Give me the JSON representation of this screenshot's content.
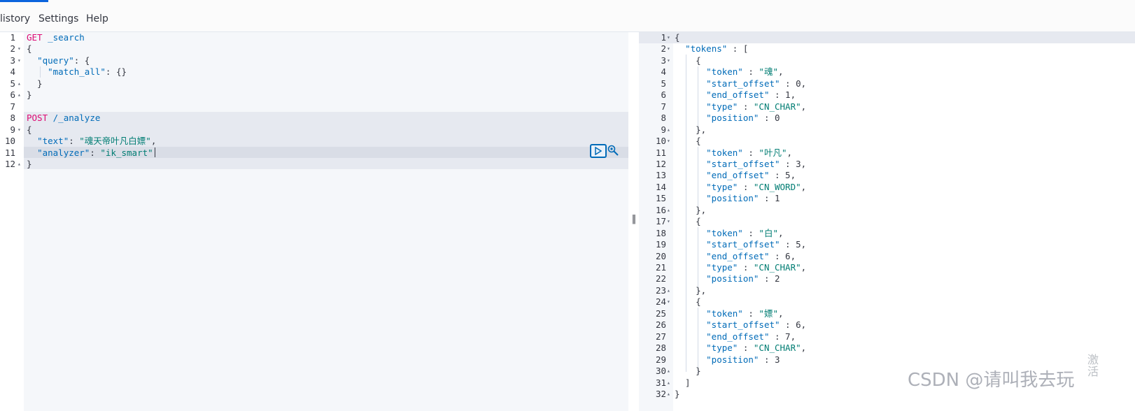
{
  "nav": {
    "tabs": [
      "listory",
      "Settings",
      "Help"
    ]
  },
  "request_editor": {
    "line_numbers": [
      "1",
      "2",
      "3",
      "4",
      "5",
      "6",
      "7",
      "8",
      "9",
      "10",
      "11",
      "12"
    ],
    "lines": [
      {
        "segments": [
          {
            "t": "kw",
            "v": "GET"
          },
          {
            "t": "code",
            "v": " "
          },
          {
            "t": "url",
            "v": "_search"
          }
        ]
      },
      {
        "segments": [
          {
            "t": "code",
            "v": "{"
          }
        ]
      },
      {
        "segments": [
          {
            "t": "code",
            "v": "  "
          },
          {
            "t": "key",
            "v": "\"query\""
          },
          {
            "t": "code",
            "v": ": {"
          }
        ]
      },
      {
        "segments": [
          {
            "t": "code",
            "v": "    "
          },
          {
            "t": "key",
            "v": "\"match_all\""
          },
          {
            "t": "code",
            "v": ": {}"
          }
        ]
      },
      {
        "segments": [
          {
            "t": "code",
            "v": "  }"
          }
        ]
      },
      {
        "segments": [
          {
            "t": "code",
            "v": "}"
          }
        ]
      },
      {
        "segments": []
      },
      {
        "segments": [
          {
            "t": "kw",
            "v": "POST"
          },
          {
            "t": "code",
            "v": " "
          },
          {
            "t": "url",
            "v": "/_analyze"
          }
        ]
      },
      {
        "segments": [
          {
            "t": "code",
            "v": "{"
          }
        ]
      },
      {
        "segments": [
          {
            "t": "code",
            "v": "  "
          },
          {
            "t": "key",
            "v": "\"text\""
          },
          {
            "t": "code",
            "v": ": "
          },
          {
            "t": "str",
            "v": "\"魂天帝叶凡白嫖\""
          },
          {
            "t": "code",
            "v": ","
          }
        ]
      },
      {
        "segments": [
          {
            "t": "code",
            "v": "  "
          },
          {
            "t": "key",
            "v": "\"analyzer\""
          },
          {
            "t": "code",
            "v": ": "
          },
          {
            "t": "str",
            "v": "\"ik_smart\""
          }
        ]
      },
      {
        "segments": [
          {
            "t": "code",
            "v": "}"
          }
        ]
      }
    ],
    "fold_markers": {
      "2": "open",
      "3": "open",
      "5": "close",
      "6": "close",
      "9": "open",
      "12": "close"
    }
  },
  "response_viewer": {
    "line_numbers": [
      "1",
      "2",
      "3",
      "4",
      "5",
      "6",
      "7",
      "8",
      "9",
      "10",
      "11",
      "12",
      "13",
      "14",
      "15",
      "16",
      "17",
      "18",
      "19",
      "20",
      "21",
      "22",
      "23",
      "24",
      "25",
      "26",
      "27",
      "28",
      "29",
      "30",
      "31",
      "32"
    ],
    "lines": [
      {
        "segments": [
          {
            "t": "code",
            "v": "{"
          }
        ]
      },
      {
        "segments": [
          {
            "t": "code",
            "v": "  "
          },
          {
            "t": "key",
            "v": "\"tokens\""
          },
          {
            "t": "code",
            "v": " : ["
          }
        ]
      },
      {
        "segments": [
          {
            "t": "code",
            "v": "    {"
          }
        ]
      },
      {
        "segments": [
          {
            "t": "code",
            "v": "      "
          },
          {
            "t": "key",
            "v": "\"token\""
          },
          {
            "t": "code",
            "v": " : "
          },
          {
            "t": "str",
            "v": "\"魂\""
          },
          {
            "t": "code",
            "v": ","
          }
        ]
      },
      {
        "segments": [
          {
            "t": "code",
            "v": "      "
          },
          {
            "t": "key",
            "v": "\"start_offset\""
          },
          {
            "t": "code",
            "v": " : 0,"
          }
        ]
      },
      {
        "segments": [
          {
            "t": "code",
            "v": "      "
          },
          {
            "t": "key",
            "v": "\"end_offset\""
          },
          {
            "t": "code",
            "v": " : 1,"
          }
        ]
      },
      {
        "segments": [
          {
            "t": "code",
            "v": "      "
          },
          {
            "t": "key",
            "v": "\"type\""
          },
          {
            "t": "code",
            "v": " : "
          },
          {
            "t": "str",
            "v": "\"CN_CHAR\""
          },
          {
            "t": "code",
            "v": ","
          }
        ]
      },
      {
        "segments": [
          {
            "t": "code",
            "v": "      "
          },
          {
            "t": "key",
            "v": "\"position\""
          },
          {
            "t": "code",
            "v": " : 0"
          }
        ]
      },
      {
        "segments": [
          {
            "t": "code",
            "v": "    },"
          }
        ]
      },
      {
        "segments": [
          {
            "t": "code",
            "v": "    {"
          }
        ]
      },
      {
        "segments": [
          {
            "t": "code",
            "v": "      "
          },
          {
            "t": "key",
            "v": "\"token\""
          },
          {
            "t": "code",
            "v": " : "
          },
          {
            "t": "str",
            "v": "\"叶凡\""
          },
          {
            "t": "code",
            "v": ","
          }
        ]
      },
      {
        "segments": [
          {
            "t": "code",
            "v": "      "
          },
          {
            "t": "key",
            "v": "\"start_offset\""
          },
          {
            "t": "code",
            "v": " : 3,"
          }
        ]
      },
      {
        "segments": [
          {
            "t": "code",
            "v": "      "
          },
          {
            "t": "key",
            "v": "\"end_offset\""
          },
          {
            "t": "code",
            "v": " : 5,"
          }
        ]
      },
      {
        "segments": [
          {
            "t": "code",
            "v": "      "
          },
          {
            "t": "key",
            "v": "\"type\""
          },
          {
            "t": "code",
            "v": " : "
          },
          {
            "t": "str",
            "v": "\"CN_WORD\""
          },
          {
            "t": "code",
            "v": ","
          }
        ]
      },
      {
        "segments": [
          {
            "t": "code",
            "v": "      "
          },
          {
            "t": "key",
            "v": "\"position\""
          },
          {
            "t": "code",
            "v": " : 1"
          }
        ]
      },
      {
        "segments": [
          {
            "t": "code",
            "v": "    },"
          }
        ]
      },
      {
        "segments": [
          {
            "t": "code",
            "v": "    {"
          }
        ]
      },
      {
        "segments": [
          {
            "t": "code",
            "v": "      "
          },
          {
            "t": "key",
            "v": "\"token\""
          },
          {
            "t": "code",
            "v": " : "
          },
          {
            "t": "str",
            "v": "\"白\""
          },
          {
            "t": "code",
            "v": ","
          }
        ]
      },
      {
        "segments": [
          {
            "t": "code",
            "v": "      "
          },
          {
            "t": "key",
            "v": "\"start_offset\""
          },
          {
            "t": "code",
            "v": " : 5,"
          }
        ]
      },
      {
        "segments": [
          {
            "t": "code",
            "v": "      "
          },
          {
            "t": "key",
            "v": "\"end_offset\""
          },
          {
            "t": "code",
            "v": " : 6,"
          }
        ]
      },
      {
        "segments": [
          {
            "t": "code",
            "v": "      "
          },
          {
            "t": "key",
            "v": "\"type\""
          },
          {
            "t": "code",
            "v": " : "
          },
          {
            "t": "str",
            "v": "\"CN_CHAR\""
          },
          {
            "t": "code",
            "v": ","
          }
        ]
      },
      {
        "segments": [
          {
            "t": "code",
            "v": "      "
          },
          {
            "t": "key",
            "v": "\"position\""
          },
          {
            "t": "code",
            "v": " : 2"
          }
        ]
      },
      {
        "segments": [
          {
            "t": "code",
            "v": "    },"
          }
        ]
      },
      {
        "segments": [
          {
            "t": "code",
            "v": "    {"
          }
        ]
      },
      {
        "segments": [
          {
            "t": "code",
            "v": "      "
          },
          {
            "t": "key",
            "v": "\"token\""
          },
          {
            "t": "code",
            "v": " : "
          },
          {
            "t": "str",
            "v": "\"嫖\""
          },
          {
            "t": "code",
            "v": ","
          }
        ]
      },
      {
        "segments": [
          {
            "t": "code",
            "v": "      "
          },
          {
            "t": "key",
            "v": "\"start_offset\""
          },
          {
            "t": "code",
            "v": " : 6,"
          }
        ]
      },
      {
        "segments": [
          {
            "t": "code",
            "v": "      "
          },
          {
            "t": "key",
            "v": "\"end_offset\""
          },
          {
            "t": "code",
            "v": " : 7,"
          }
        ]
      },
      {
        "segments": [
          {
            "t": "code",
            "v": "      "
          },
          {
            "t": "key",
            "v": "\"type\""
          },
          {
            "t": "code",
            "v": " : "
          },
          {
            "t": "str",
            "v": "\"CN_CHAR\""
          },
          {
            "t": "code",
            "v": ","
          }
        ]
      },
      {
        "segments": [
          {
            "t": "code",
            "v": "      "
          },
          {
            "t": "key",
            "v": "\"position\""
          },
          {
            "t": "code",
            "v": " : 3"
          }
        ]
      },
      {
        "segments": [
          {
            "t": "code",
            "v": "    }"
          }
        ]
      },
      {
        "segments": [
          {
            "t": "code",
            "v": "  ]"
          }
        ]
      },
      {
        "segments": [
          {
            "t": "code",
            "v": "}"
          }
        ]
      }
    ],
    "fold_markers": {
      "1": "open",
      "2": "open",
      "3": "open",
      "9": "close",
      "10": "open",
      "16": "close",
      "17": "open",
      "23": "close",
      "24": "open",
      "30": "close",
      "31": "close",
      "32": "close"
    }
  },
  "icons": {
    "run": "play-icon",
    "settings": "wrench-icon",
    "resizer": "resize-handle-icon"
  },
  "resizer_glyph": "‖",
  "watermark": {
    "text": "CSDN @请叫我去玩",
    "side": "激活"
  },
  "colors": {
    "accent": "#0b64dd",
    "method": "#dd0a73",
    "key": "#006bb8",
    "string": "#017d73"
  }
}
